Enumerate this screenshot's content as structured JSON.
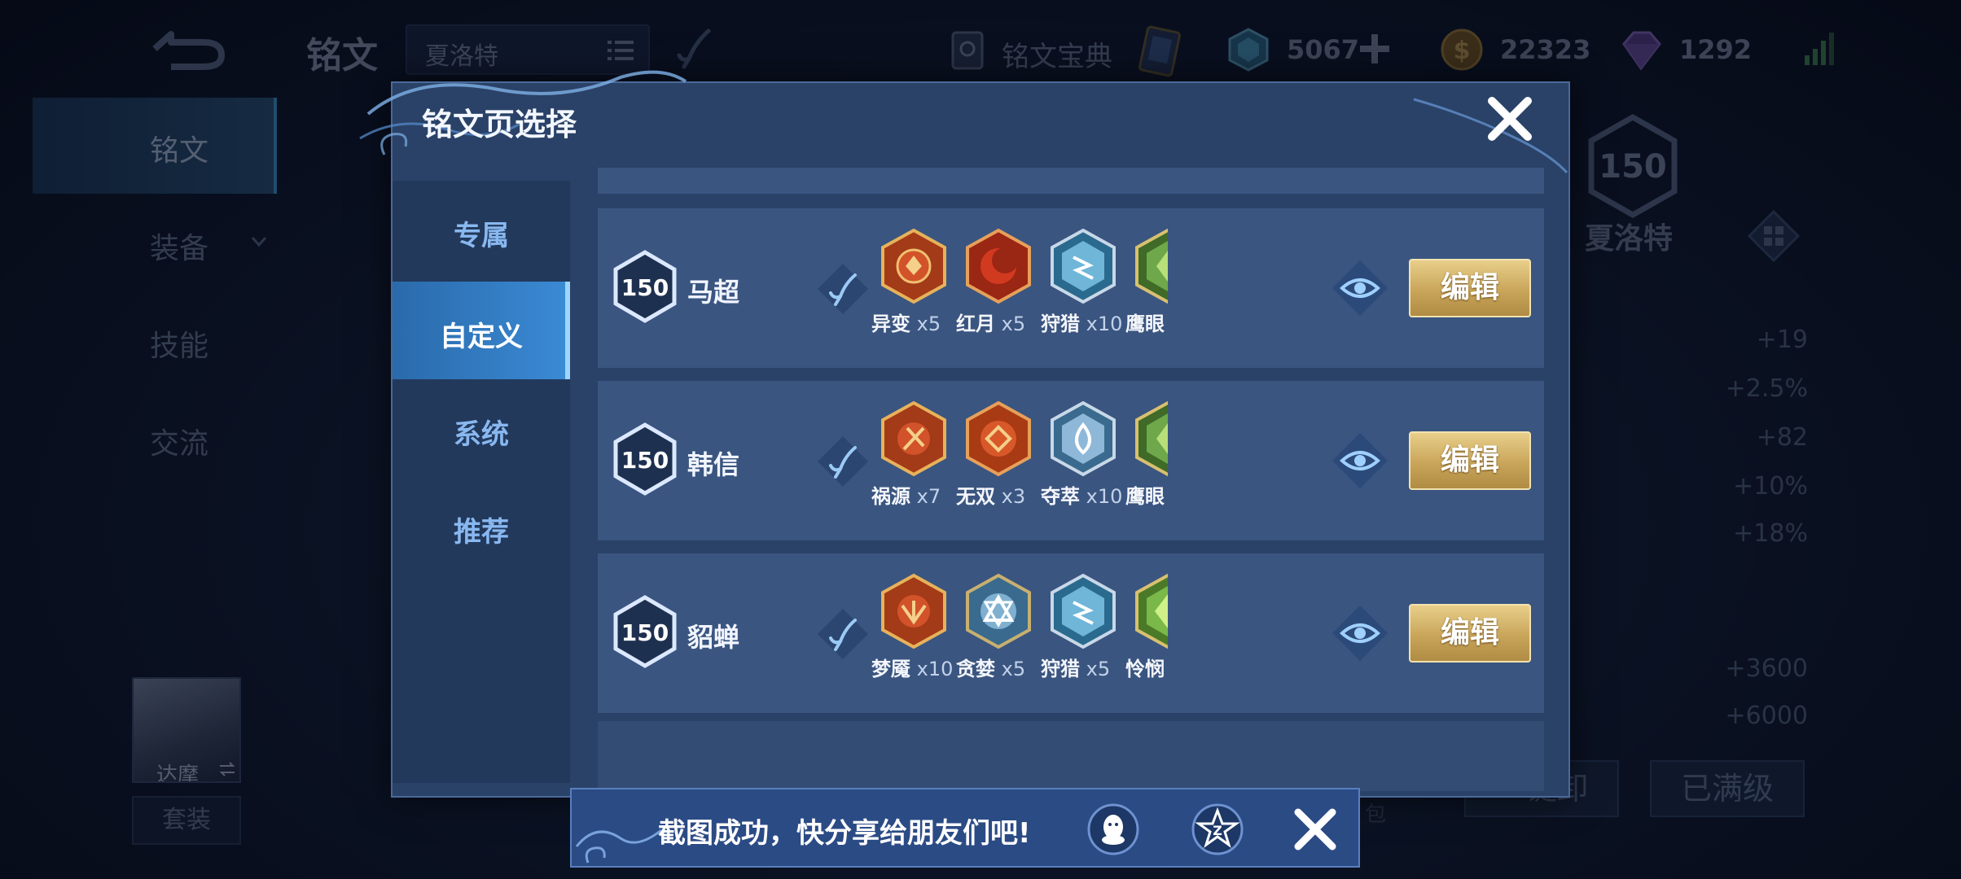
{
  "header": {
    "title": "铭文",
    "hero_select": "夏洛特",
    "codex_label": "铭文宝典",
    "currencies": [
      {
        "icon": "ice-crystal-icon",
        "value": "5067"
      },
      {
        "icon": "gold-coin-icon",
        "value": "22323"
      },
      {
        "icon": "gem-icon",
        "value": "1292"
      }
    ]
  },
  "left_nav": [
    {
      "label": "铭文",
      "active": true
    },
    {
      "label": "装备",
      "active": false
    },
    {
      "label": "技能",
      "active": false
    },
    {
      "label": "交流",
      "active": false
    }
  ],
  "hero_avatar": {
    "name": "达摩",
    "outfit_label": "套装"
  },
  "background_panel": {
    "level": "150",
    "hero_name": "夏洛特",
    "stats": [
      "+19",
      "+2.5%",
      "+82",
      "+10%",
      "+18%",
      "+3600",
      "+6000"
    ],
    "unload_label": "一键卸",
    "bag_label": "包",
    "maxed_label": "已满级"
  },
  "modal": {
    "title": "铭文页选择",
    "tabs": [
      {
        "label": "专属",
        "active": false
      },
      {
        "label": "自定义",
        "active": true
      },
      {
        "label": "系统",
        "active": false
      },
      {
        "label": "推荐",
        "active": false
      }
    ],
    "pages": [
      {
        "level": "150",
        "hero": "马超",
        "runes": [
          {
            "name": "异变",
            "count": "x5",
            "color": "#d2522a"
          },
          {
            "name": "红月",
            "count": "x5",
            "color": "#c9331f"
          },
          {
            "name": "狩猎",
            "count": "x10",
            "color": "#6fb6d8"
          },
          {
            "name": "鹰眼",
            "count": "",
            "color": "#6fa84a"
          }
        ],
        "edit_label": "编辑"
      },
      {
        "level": "150",
        "hero": "韩信",
        "runes": [
          {
            "name": "祸源",
            "count": "x7",
            "color": "#d2522a"
          },
          {
            "name": "无双",
            "count": "x3",
            "color": "#c9331f"
          },
          {
            "name": "夺萃",
            "count": "x10",
            "color": "#8fb8d8"
          },
          {
            "name": "鹰眼",
            "count": "",
            "color": "#6fa84a"
          }
        ],
        "edit_label": "编辑"
      },
      {
        "level": "150",
        "hero": "貂蝉",
        "runes": [
          {
            "name": "梦魇",
            "count": "x10",
            "color": "#d2522a"
          },
          {
            "name": "贪婪",
            "count": "x5",
            "color": "#7fb0d0"
          },
          {
            "name": "狩猎",
            "count": "x5",
            "color": "#6fb6d8"
          },
          {
            "name": "怜悯",
            "count": "",
            "color": "#7ab84a"
          }
        ],
        "edit_label": "编辑"
      }
    ]
  },
  "toast": {
    "message": "截图成功，快分享给朋友们吧!"
  }
}
